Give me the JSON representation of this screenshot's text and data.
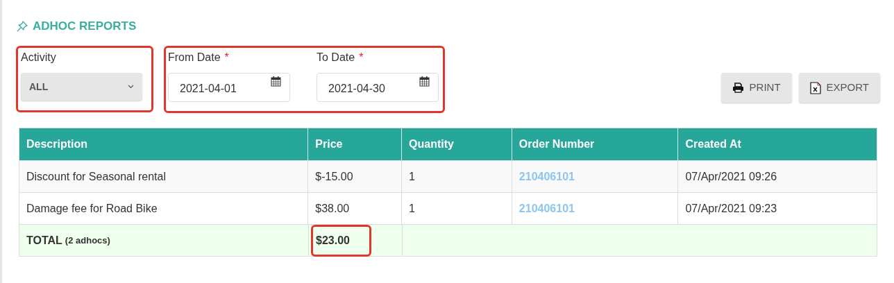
{
  "title": "ADHOC REPORTS",
  "filters": {
    "activity": {
      "label": "Activity",
      "value": "ALL",
      "highlighted": true
    },
    "dates": {
      "highlighted": true,
      "fields": [
        {
          "label": "From Date",
          "required_mark": "*",
          "value": "2021-04-01"
        },
        {
          "label": "To Date",
          "required_mark": "*",
          "value": "2021-04-30"
        }
      ]
    }
  },
  "buttons": [
    {
      "kind": "print",
      "label": "PRINT"
    },
    {
      "kind": "export",
      "label": "EXPORT"
    }
  ],
  "table": {
    "columns": [
      "Description",
      "Price",
      "Quantity",
      "Order Number",
      "Created At"
    ],
    "rows": [
      {
        "description": "Discount for Seasonal rental",
        "price": "$-15.00",
        "quantity": "1",
        "order_number": "210406101",
        "created_at": "07/Apr/2021 09:26"
      },
      {
        "description": "Damage fee for Road Bike",
        "price": "$38.00",
        "quantity": "1",
        "order_number": "210406101",
        "created_at": "07/Apr/2021 09:23"
      }
    ],
    "total": {
      "label": "TOTAL",
      "note": "(2 adhocs)",
      "price": "$23.00",
      "highlighted": true
    }
  }
}
